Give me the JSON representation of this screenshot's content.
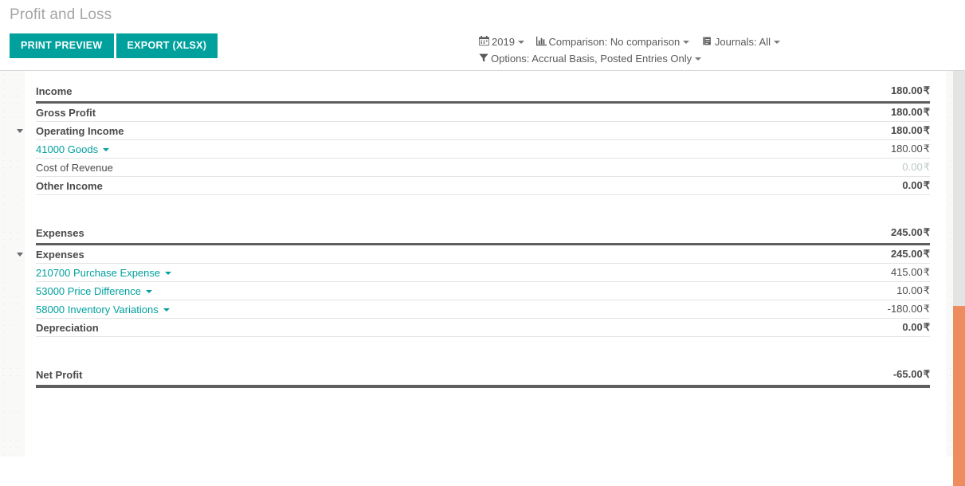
{
  "header": {
    "title": "Profit and Loss",
    "buttons": [
      {
        "label": "PRINT PREVIEW",
        "name": "print-preview-button"
      },
      {
        "label": "EXPORT (XLSX)",
        "name": "export-xlsx-button"
      }
    ],
    "filters": {
      "date": {
        "icon": "calendar-icon",
        "glyph": "📅",
        "label": "2019"
      },
      "comparison": {
        "icon": "bar-chart-icon",
        "glyph": "📊",
        "label": "Comparison: No comparison"
      },
      "journals": {
        "icon": "book-icon",
        "glyph": "📕",
        "label": "Journals: All"
      },
      "options": {
        "icon": "funnel-icon",
        "glyph": "▼",
        "label": "Options: Accrual Basis, Posted Entries Only"
      }
    }
  },
  "report": {
    "currency": "₹",
    "rows": [
      {
        "type": "section-head",
        "indent": 0,
        "label": "Income",
        "value": "180.00",
        "bold": true
      },
      {
        "type": "row",
        "indent": 1,
        "label": "Gross Profit",
        "value": "180.00",
        "bold": true
      },
      {
        "type": "row",
        "indent": 2,
        "label": "Operating Income",
        "value": "180.00",
        "bold": true,
        "toggle": true
      },
      {
        "type": "row",
        "indent": 3,
        "label": "41000 Goods",
        "value": "180.00",
        "link": true
      },
      {
        "type": "row",
        "indent": 2,
        "label": "Cost of Revenue",
        "value": "0.00",
        "muted": true
      },
      {
        "type": "row",
        "indent": 1,
        "label": "Other Income",
        "value": "0.00",
        "bold": true
      },
      {
        "type": "spacer"
      },
      {
        "type": "section-head",
        "indent": 0,
        "label": "Expenses",
        "value": "245.00",
        "bold": true
      },
      {
        "type": "row",
        "indent": 1,
        "label": "Expenses",
        "value": "245.00",
        "bold": true,
        "toggle": true
      },
      {
        "type": "row",
        "indent": 2,
        "label": "210700 Purchase Expense",
        "value": "415.00",
        "link": true
      },
      {
        "type": "row",
        "indent": 2,
        "label": "53000 Price Difference",
        "value": "10.00",
        "link": true
      },
      {
        "type": "row",
        "indent": 2,
        "label": "58000 Inventory Variations",
        "value": "-180.00",
        "link": true
      },
      {
        "type": "row",
        "indent": 1,
        "label": "Depreciation",
        "value": "0.00",
        "bold": true
      },
      {
        "type": "spacer"
      },
      {
        "type": "total-head",
        "indent": 0,
        "label": "Net Profit",
        "value": "-65.00",
        "bold": true
      }
    ]
  },
  "scrollbar": {
    "name": "vertical-scrollbar",
    "thumb_color": "#ee8b5f",
    "track_color": "#e4e4e4"
  }
}
